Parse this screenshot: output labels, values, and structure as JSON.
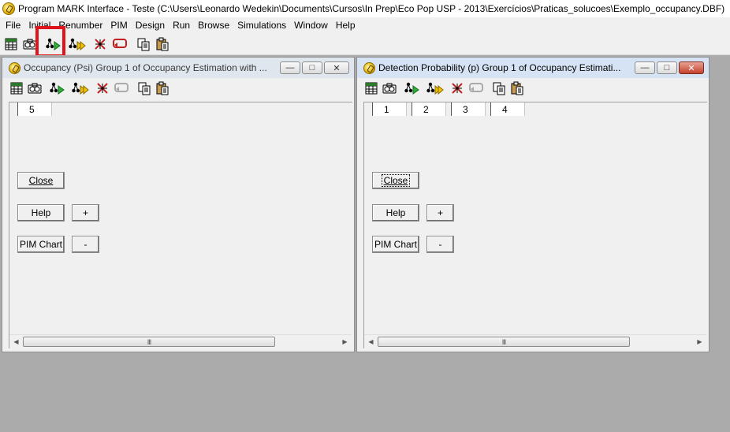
{
  "app": {
    "title": "Program MARK Interface - Teste  (C:\\Users\\Leonardo Wedekin\\Documents\\Cursos\\In Prep\\Eco Pop USP - 2013\\Exercícios\\Praticas_solucoes\\Exemplo_occupancy.DBF)"
  },
  "menu": [
    "File",
    "Initial",
    "Renumber",
    "PIM",
    "Design",
    "Run",
    "Browse",
    "Simulations",
    "Window",
    "Help"
  ],
  "toolbar_icons": [
    "spreadsheet-icon",
    "camera-icon",
    "run-icon",
    "run-current-icon",
    "delete-pim-icon",
    "undo-icon",
    "copy-icon",
    "paste-icon"
  ],
  "highlight": {
    "color": "#e0141d"
  },
  "windows": [
    {
      "title": "Occupancy (Psi) Group 1 of Occupancy Estimation with ...",
      "cells": [
        "5"
      ],
      "buttons": {
        "close": "Close",
        "help": "Help",
        "plus": "+",
        "pimchart": "PIM Chart",
        "minus": "-"
      },
      "scroll_glyph": "III"
    },
    {
      "title": "Detection Probability (p) Group 1 of Occupancy Estimati...",
      "cells": [
        "1",
        "2",
        "3",
        "4"
      ],
      "buttons": {
        "close": "Close",
        "help": "Help",
        "plus": "+",
        "pimchart": "PIM Chart",
        "minus": "-"
      },
      "scroll_glyph": "III"
    }
  ],
  "window_controls": {
    "minimize": "—",
    "restore": "□",
    "close": "✕"
  },
  "scroll_arrows": {
    "left": "◀",
    "right": "▶"
  }
}
